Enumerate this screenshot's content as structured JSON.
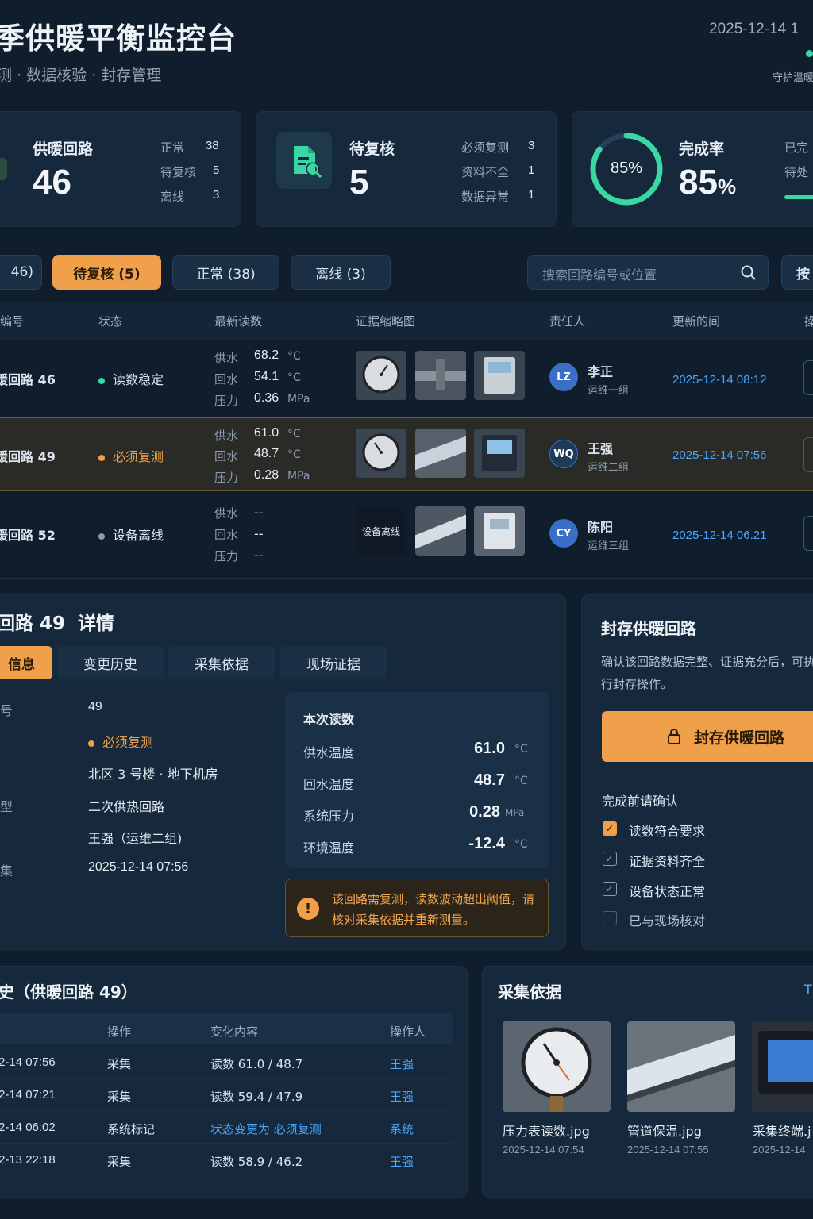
{
  "header": {
    "title": "季供暖平衡监控台",
    "subtitle": "测 · 数据核验 · 封存管理",
    "datetime": "2025-12-14  1",
    "guard_label": "守护温暖"
  },
  "stats": {
    "loops": {
      "label": "供暖回路",
      "value": "46",
      "rows": [
        {
          "k": "正常",
          "v": "38"
        },
        {
          "k": "待复核",
          "v": "5"
        },
        {
          "k": "离线",
          "v": "3"
        }
      ]
    },
    "review": {
      "label": "待复核",
      "value": "5",
      "rows": [
        {
          "k": "必须复测",
          "v": "3"
        },
        {
          "k": "资料不全",
          "v": "1"
        },
        {
          "k": "数据异常",
          "v": "1"
        }
      ]
    },
    "completion": {
      "label": "完成率",
      "value": "85",
      "unit": "%",
      "ring_label": "85%",
      "fraction": 0.85,
      "rows": [
        {
          "k": "已完"
        },
        {
          "k": "待处"
        }
      ]
    }
  },
  "filters": {
    "all": "46)",
    "review": "待复核 (5)",
    "normal": "正常 (38)",
    "offline": "离线 (3)",
    "search_placeholder": "搜索回路编号或位置",
    "sort": "按"
  },
  "table": {
    "headers": {
      "id": "编号",
      "status": "状态",
      "reading": "最新读数",
      "evidence": "证据缩略图",
      "owner": "责任人",
      "updated": "更新的间",
      "action": "操"
    },
    "labels": {
      "supply": "供水",
      "return": "回水",
      "pressure": "压力"
    },
    "rows": [
      {
        "id": "暖回路 46",
        "status": "读数稳定",
        "status_color": "#3ad6a4",
        "supply": "68.2",
        "supply_unit": "°C",
        "return": "54.1",
        "return_unit": "°C",
        "pressure": "0.36",
        "pressure_unit": "MPa",
        "avatar": "LZ",
        "owner": "李正",
        "team": "运维一组",
        "updated": "2025-12-14 08:12"
      },
      {
        "id": "暖回路 49",
        "status": "必须复测",
        "status_color": "#f0a04b",
        "supply": "61.0",
        "supply_unit": "°C",
        "return": "48.7",
        "return_unit": "°C",
        "pressure": "0.28",
        "pressure_unit": "MPa",
        "avatar": "WQ",
        "owner": "王强",
        "team": "运维二组",
        "updated": "2025-12-14 07:56"
      },
      {
        "id": "暖回路 52",
        "status": "设备离线",
        "status_color": "#8a9bb0",
        "supply": "--",
        "return": "--",
        "pressure": "--",
        "avatar": "CY",
        "owner": "陈阳",
        "team": "运维三组",
        "updated": "2025-12-14 06.21",
        "offline_thumb": "设备离线"
      }
    ]
  },
  "detail": {
    "title": "回路 49  详情",
    "tabs": [
      "信息",
      "变更历史",
      "采集依据",
      "现场证据"
    ],
    "info": [
      {
        "k": "号",
        "v": "49"
      },
      {
        "k": "",
        "v": "必须复测"
      },
      {
        "k": "",
        "v": "北区 3 号楼 · 地下机房"
      },
      {
        "k": "型",
        "v": "二次供热回路"
      },
      {
        "k": "",
        "v": "王强（运维二组)"
      },
      {
        "k": "集",
        "v": "2025-12-14 07:56"
      }
    ],
    "reading_title": "本次读数",
    "readings": [
      {
        "k": "供水温度",
        "v": "61.0",
        "u": "°C"
      },
      {
        "k": "回水温度",
        "v": "48.7",
        "u": "°C"
      },
      {
        "k": "系统压力",
        "v": "0.28",
        "u": "MPa"
      },
      {
        "k": "环境温度",
        "v": "-12.4",
        "u": "°C"
      }
    ],
    "warning": "该回路需复测，读数波动超出阈值，请核对采集依据并重新测量。"
  },
  "seal": {
    "title": "封存供暖回路",
    "desc": "确认该回路数据完整、证据充分后，可执行封存操作。",
    "button": "封存供暖回路",
    "confirm_title": "完成前请确认",
    "checks": [
      {
        "label": "读数符合要求",
        "state": "on"
      },
      {
        "label": "证据资料齐全",
        "state": "check"
      },
      {
        "label": "设备状态正常",
        "state": "check"
      },
      {
        "label": "已与现场核对",
        "state": "off"
      }
    ]
  },
  "history": {
    "title": "史（供暖回路 49）",
    "headers": {
      "op": "操作",
      "change": "变化内容",
      "user": "操作人"
    },
    "rows": [
      {
        "time": "2-14 07:56",
        "op": "采集",
        "change": "读数 61.0 / 48.7",
        "user": "王强",
        "change_link": false
      },
      {
        "time": "2-14 07:21",
        "op": "采集",
        "change": "读数 59.4 / 47.9",
        "user": "王强",
        "change_link": false
      },
      {
        "time": "2-14 06:02",
        "op": "系统标记",
        "change": "状态变更为 必须复测",
        "user": "系统",
        "change_link": true
      },
      {
        "time": "2-13 22:18",
        "op": "采集",
        "change": "读数 58.9 / 46.2",
        "user": "王强",
        "change_link": false
      }
    ]
  },
  "basis": {
    "title": "采集依据",
    "link": "T",
    "photos": [
      {
        "name": "压力表读数.jpg",
        "time": "2025-12-14 07:54"
      },
      {
        "name": "管道保温.jpg",
        "time": "2025-12-14 07:55"
      },
      {
        "name": "采集终端.j",
        "time": "2025-12-14"
      }
    ]
  }
}
